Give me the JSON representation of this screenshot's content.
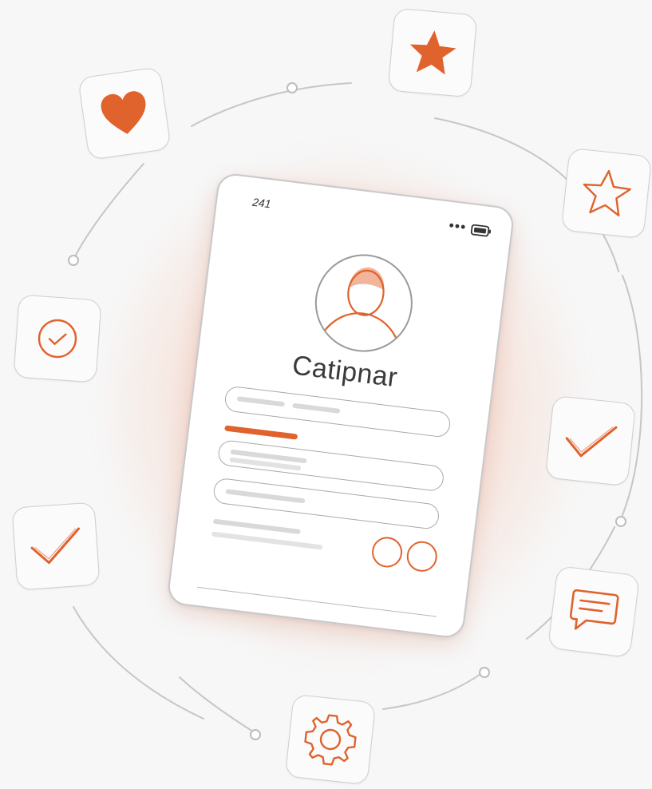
{
  "colors": {
    "accent": "#e0622c",
    "outline": "#cfcfcf",
    "background": "#f7f7f7"
  },
  "status_bar": {
    "time": "241",
    "signal": "•••",
    "battery_icon": "battery-icon"
  },
  "profile": {
    "avatar_icon": "user-avatar-icon",
    "name": "Catipnar"
  },
  "tiles": [
    {
      "icon": "heart-icon",
      "style": "filled"
    },
    {
      "icon": "star-icon",
      "style": "filled"
    },
    {
      "icon": "star-outline-icon",
      "style": "outline"
    },
    {
      "icon": "check-circle-icon",
      "style": "outline"
    },
    {
      "icon": "checkmark-icon",
      "style": "outline"
    },
    {
      "icon": "checkmark-icon",
      "style": "outline"
    },
    {
      "icon": "chat-icon",
      "style": "outline"
    },
    {
      "icon": "gear-icon",
      "style": "outline"
    }
  ],
  "actions": [
    "circle-button-1",
    "circle-button-2"
  ]
}
